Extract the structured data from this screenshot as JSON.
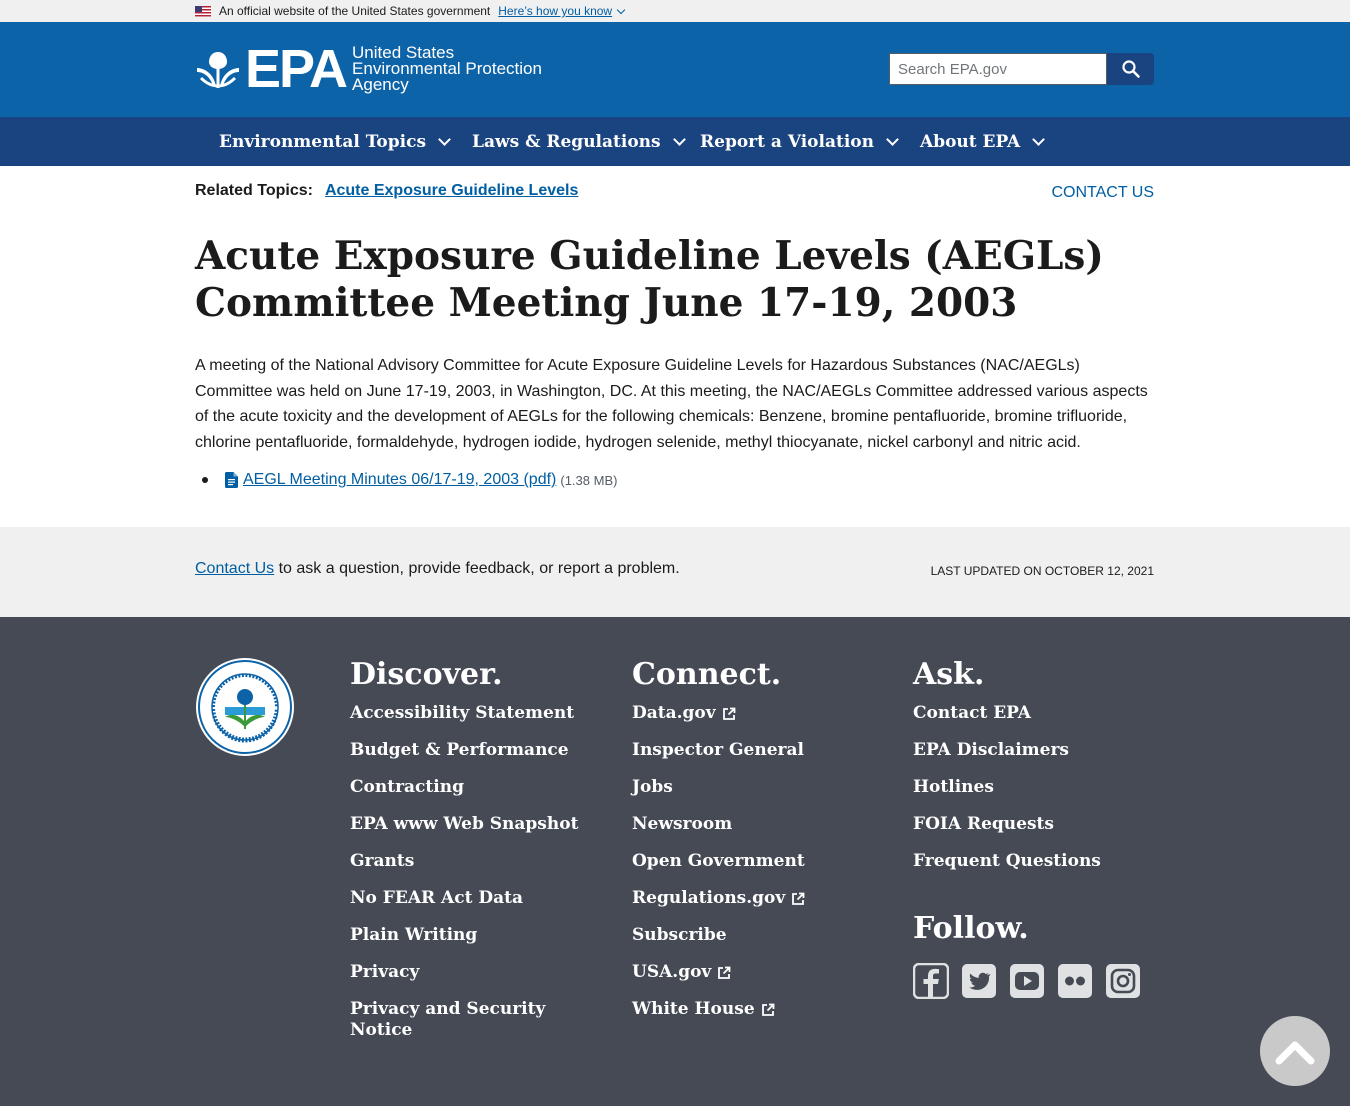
{
  "gov_banner": {
    "text": "An official website of the United States government",
    "link": "Here’s how you know"
  },
  "header": {
    "logo_abbr": "EPA",
    "logo_line1": "United States",
    "logo_line2": "Environmental Protection",
    "logo_line3": "Agency",
    "search_placeholder": "Search EPA.gov"
  },
  "nav": {
    "items": [
      {
        "label": "Environmental Topics"
      },
      {
        "label": "Laws & Regulations"
      },
      {
        "label": "Report a Violation"
      },
      {
        "label": "About EPA"
      }
    ]
  },
  "related": {
    "label": "Related Topics:",
    "link": "Acute Exposure Guideline Levels"
  },
  "contact_top": "CONTACT US",
  "page": {
    "title": "Acute Exposure Guideline Levels (AEGLs) Committee Meeting June 17-19, 2003",
    "intro": " A meeting of the National Advisory Committee for Acute Exposure Guideline Levels for Hazardous Substances (NAC/AEGLs) Committee was held on June 17-19, 2003, in Washington, DC. At this meeting, the NAC/AEGLs Committee addressed various aspects of the acute toxicity and the development of AEGLs for the following chemicals: Benzene, bromine pentafluoride, bromine trifluoride, chlorine pentafluoride, formaldehyde, hydrogen iodide, hydrogen selenide, methyl thiocyanate, nickel carbonyl and nitric acid.",
    "documents": [
      {
        "label": "AEGL Meeting Minutes 06/17-19, 2003 (pdf)",
        "size": "(1.38 MB)"
      }
    ]
  },
  "feedback": {
    "link": "Contact Us",
    "text": " to ask a question, provide feedback, or report a problem.",
    "updated": "Last updated on October 12, 2021"
  },
  "footer": {
    "discover": {
      "heading": "Discover.",
      "links": [
        "Accessibility Statement",
        "Budget & Performance",
        "Contracting",
        "EPA www Web Snapshot",
        "Grants",
        "No FEAR Act Data",
        "Plain Writing",
        "Privacy",
        "Privacy and Security Notice"
      ]
    },
    "connect": {
      "heading": "Connect.",
      "links": [
        "Data.gov",
        "Inspector General",
        "Jobs",
        "Newsroom",
        "Open Government",
        "Regulations.gov",
        "Subscribe",
        "USA.gov",
        "White House"
      ]
    },
    "ask": {
      "heading": "Ask.",
      "links": [
        "Contact EPA",
        "EPA Disclaimers",
        "Hotlines",
        "FOIA Requests",
        "Frequent Questions"
      ]
    },
    "follow": {
      "heading": "Follow.",
      "icons": [
        "facebook-icon",
        "twitter-icon",
        "youtube-icon",
        "flickr-icon",
        "instagram-icon"
      ]
    },
    "seal_text": "UNITED STATES ENVIRONMENTAL PROTECTION AGENCY"
  },
  "colors": {
    "header_blue": "#0d63a8",
    "nav_blue": "#1a4480",
    "link_blue": "#005ea2",
    "footer_gray": "#454a55"
  }
}
